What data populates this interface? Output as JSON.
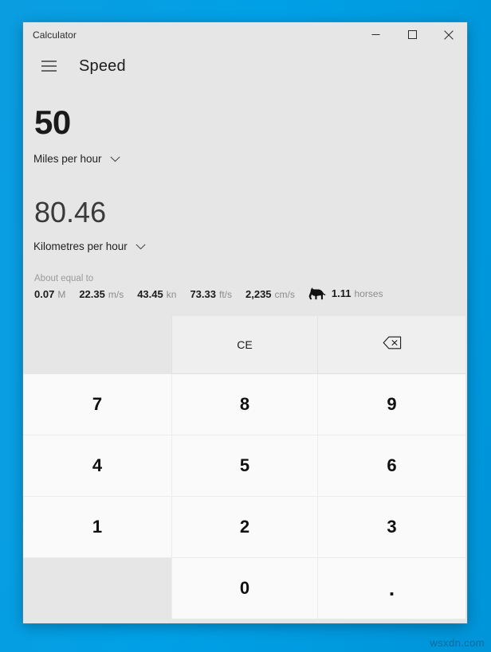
{
  "desktop": {
    "watermark": "wsxdn.com",
    "background_color": "#009ae0"
  },
  "window": {
    "title": "Calculator",
    "controls": {
      "minimize": "minimize-icon",
      "maximize": "maximize-icon",
      "close": "close-icon"
    }
  },
  "header": {
    "menu_icon": "hamburger-icon",
    "page_title": "Speed"
  },
  "converter": {
    "from": {
      "value": "50",
      "unit": "Miles per hour",
      "chevron": "chevron-down-icon"
    },
    "to": {
      "value": "80.46",
      "unit": "Kilometres per hour",
      "chevron": "chevron-down-icon"
    },
    "about_equal_label": "About equal to",
    "equivalents": [
      {
        "value": "0.07",
        "unit": "M",
        "icon": ""
      },
      {
        "value": "22.35",
        "unit": "m/s",
        "icon": ""
      },
      {
        "value": "43.45",
        "unit": "kn",
        "icon": ""
      },
      {
        "value": "73.33",
        "unit": "ft/s",
        "icon": ""
      },
      {
        "value": "2,235",
        "unit": "cm/s",
        "icon": ""
      },
      {
        "value": "1.11",
        "unit": "horses",
        "icon": "horse-icon"
      }
    ]
  },
  "keypad": {
    "rows": [
      [
        {
          "label": "",
          "name": "key-blank-top",
          "type": "blank"
        },
        {
          "label": "CE",
          "name": "key-clear-entry",
          "type": "fn"
        },
        {
          "label": "",
          "name": "key-backspace",
          "type": "fn",
          "icon": "backspace-icon"
        }
      ],
      [
        {
          "label": "7",
          "name": "key-7",
          "type": "num"
        },
        {
          "label": "8",
          "name": "key-8",
          "type": "num"
        },
        {
          "label": "9",
          "name": "key-9",
          "type": "num"
        }
      ],
      [
        {
          "label": "4",
          "name": "key-4",
          "type": "num"
        },
        {
          "label": "5",
          "name": "key-5",
          "type": "num"
        },
        {
          "label": "6",
          "name": "key-6",
          "type": "num"
        }
      ],
      [
        {
          "label": "1",
          "name": "key-1",
          "type": "num"
        },
        {
          "label": "2",
          "name": "key-2",
          "type": "num"
        },
        {
          "label": "3",
          "name": "key-3",
          "type": "num"
        }
      ],
      [
        {
          "label": "",
          "name": "key-blank-bottom",
          "type": "blank"
        },
        {
          "label": "0",
          "name": "key-0",
          "type": "num"
        },
        {
          "label": ".",
          "name": "key-decimal",
          "type": "num"
        }
      ]
    ]
  }
}
